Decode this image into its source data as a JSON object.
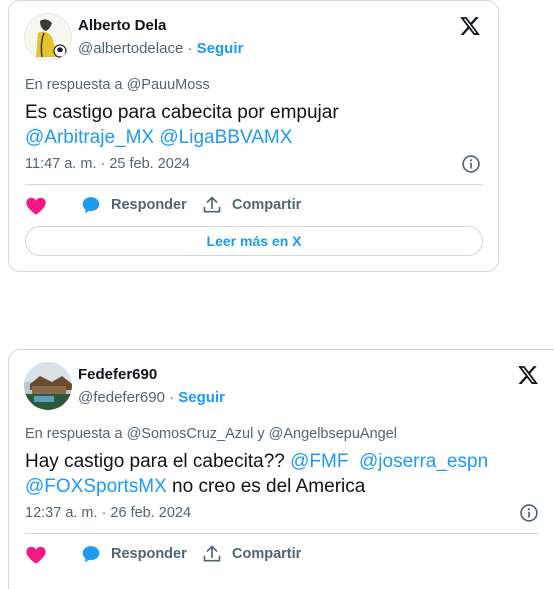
{
  "tweets": [
    {
      "name": "Alberto Dela",
      "handle": "@albertodelace",
      "separator": "·",
      "follow": "Seguir",
      "reply_prefix": "En respuesta a",
      "reply_users": "@PauuMoss",
      "text": "Es castigo para cabecita por empujar",
      "mentions": [
        "@Arbitraje_MX",
        "@LigaBBVAMX"
      ],
      "time": "11:47 a. m. · 25 feb. 2024",
      "actions": {
        "reply": "Responder",
        "share": "Compartir"
      },
      "read_more": "Leer más en X"
    },
    {
      "name": "Fedefer690",
      "handle": "@fedefer690",
      "separator": "·",
      "follow": "Seguir",
      "reply_prefix": "En respuesta a",
      "reply_users": "@SomosCruz_Azul y @AngelbsepuAngel",
      "text_lead": "Hay castigo para el cabecita??",
      "mentions": [
        "@FMF",
        "@joserra_espn",
        "@FOXSportsMX"
      ],
      "text_tail": "no creo es del America",
      "time": "12:37 a. m. · 26 feb. 2024",
      "actions": {
        "reply": "Responder",
        "share": "Compartir"
      }
    }
  ],
  "icons": {
    "brand": "x-logo-icon",
    "info": "info-icon",
    "like": "heart-icon",
    "reply": "speech-bubble-icon",
    "share": "share-icon"
  },
  "colors": {
    "link": "#1d9bf0",
    "like": "#f91880",
    "text": "#0f1419",
    "muted": "#536471",
    "border": "#cfd9de"
  }
}
